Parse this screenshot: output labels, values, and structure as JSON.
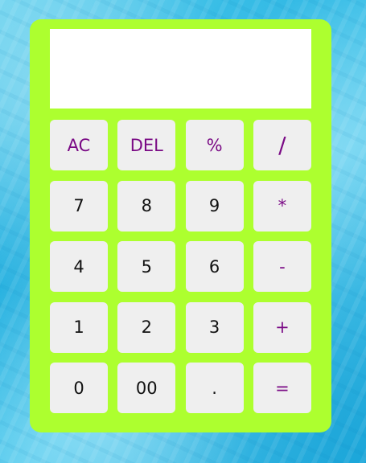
{
  "display": {
    "value": ""
  },
  "colors": {
    "calculator_body": "#adff2f",
    "key_background": "#efefef",
    "operator_text": "#7a0a85",
    "number_text": "#111111",
    "display_background": "#ffffff"
  },
  "keys": [
    {
      "label": "AC",
      "type": "operator"
    },
    {
      "label": "DEL",
      "type": "operator"
    },
    {
      "label": "%",
      "type": "operator"
    },
    {
      "label": "/",
      "type": "operator"
    },
    {
      "label": "7",
      "type": "number"
    },
    {
      "label": "8",
      "type": "number"
    },
    {
      "label": "9",
      "type": "number"
    },
    {
      "label": "*",
      "type": "operator"
    },
    {
      "label": "4",
      "type": "number"
    },
    {
      "label": "5",
      "type": "number"
    },
    {
      "label": "6",
      "type": "number"
    },
    {
      "label": "-",
      "type": "operator"
    },
    {
      "label": "1",
      "type": "number"
    },
    {
      "label": "2",
      "type": "number"
    },
    {
      "label": "3",
      "type": "number"
    },
    {
      "label": "+",
      "type": "operator"
    },
    {
      "label": "0",
      "type": "number"
    },
    {
      "label": "00",
      "type": "number"
    },
    {
      "label": ".",
      "type": "number"
    },
    {
      "label": "=",
      "type": "operator"
    }
  ]
}
